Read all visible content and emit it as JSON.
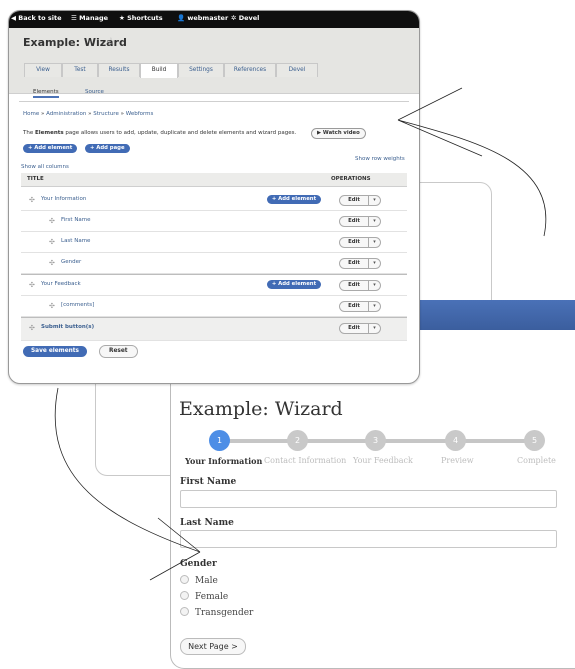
{
  "toolbar": {
    "back_to_site": "Back to site",
    "manage": "Manage",
    "shortcuts": "Shortcuts",
    "user": "webmaster",
    "devel": "Devel"
  },
  "page": {
    "title": "Example: Wizard",
    "tabs": [
      "View",
      "Test",
      "Results",
      "Build",
      "Settings",
      "References",
      "Devel"
    ],
    "active_tab": "Build",
    "subtabs": [
      "Elements",
      "Source"
    ],
    "active_subtab": "Elements",
    "breadcrumb": [
      "Home",
      "Administration",
      "Structure",
      "Webforms"
    ],
    "breadcrumb_sep": "»",
    "description_pre": "The ",
    "description_bold": "Elements",
    "description_post": " page allows users to add, update, duplicate and delete elements and wizard pages.",
    "watch_video": "▶ Watch video",
    "add_element": "+ Add element",
    "add_page": "+ Add page",
    "show_all_columns": "Show all columns",
    "show_row_weights": "Show row weights",
    "table": {
      "col_title": "TITLE",
      "col_operations": "OPERATIONS",
      "rows": [
        {
          "label": "Your Information",
          "add": "+ Add element",
          "edit": "Edit"
        },
        {
          "label": "First Name",
          "edit": "Edit"
        },
        {
          "label": "Last Name",
          "edit": "Edit"
        },
        {
          "label": "Gender",
          "edit": "Edit"
        },
        {
          "label": "Your Feedback",
          "add": "+ Add element",
          "edit": "Edit"
        },
        {
          "label": "[comments]",
          "edit": "Edit"
        },
        {
          "label": "Submit button(s)",
          "edit": "Edit"
        }
      ]
    },
    "save_elements": "Save elements",
    "reset": "Reset"
  },
  "form": {
    "title": "Example: Wizard",
    "steps": [
      {
        "num": "1",
        "label": "Your Information"
      },
      {
        "num": "2",
        "label": "Contact Information"
      },
      {
        "num": "3",
        "label": "Your Feedback"
      },
      {
        "num": "4",
        "label": "Preview"
      },
      {
        "num": "5",
        "label": "Complete"
      }
    ],
    "first_name_label": "First Name",
    "last_name_label": "Last Name",
    "gender_label": "Gender",
    "gender_options": [
      "Male",
      "Female",
      "Transgender"
    ],
    "next_button": "Next Page >"
  },
  "colors": {
    "accent": "#416bb5",
    "active_step": "#4d8ee6",
    "toolbar_bg": "#0f0f0f"
  },
  "icons": {
    "back": "chevron-left-icon",
    "manage": "hamburger-icon",
    "shortcuts": "star-icon",
    "user": "user-icon",
    "devel": "gear-icon",
    "favorite": "star-outline-icon",
    "drag": "drag-handle-icon",
    "dropdown": "caret-down-icon",
    "radio": "radio-icon"
  }
}
